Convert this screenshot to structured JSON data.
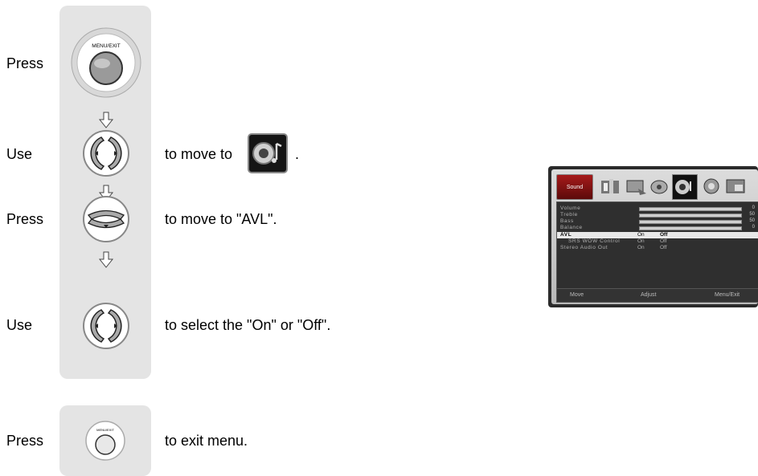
{
  "steps": [
    {
      "verb": "Press",
      "button": "menu-exit-button",
      "button_label": "MENU/EXIT",
      "text": ""
    },
    {
      "verb": "Use",
      "button": "left-right-button",
      "text": "to move to",
      "suffix": "."
    },
    {
      "verb": "Press",
      "button": "down-button",
      "text": "to move to  \"AVL\"."
    },
    {
      "verb": "Use",
      "button": "left-right-button",
      "text": "to select the \"On\" or \"Off\"."
    }
  ],
  "exit_step": {
    "verb": "Press",
    "button_label": "MENU/EXIT",
    "text": "to exit menu."
  },
  "osd": {
    "tab": "Sound",
    "icons": [
      "picture-icon",
      "screen-icon",
      "satellite-icon",
      "sound-icon",
      "settings-icon",
      "pip-icon"
    ],
    "rows": [
      {
        "label": "Volume",
        "value": "0",
        "fill": 0.0
      },
      {
        "label": "Treble",
        "value": "50",
        "fill": 0.5
      },
      {
        "label": "Bass",
        "value": "50",
        "fill": 0.5
      },
      {
        "label": "Balance",
        "value": "0",
        "fill": 0.5
      }
    ],
    "options": [
      {
        "label": "AVL",
        "on": "On",
        "off": "Off",
        "selected": true
      },
      {
        "label": "SRS WOW Control",
        "on": "On",
        "off": "Off",
        "selected": false
      },
      {
        "label": "Stereo Audio Out",
        "on": "On",
        "off": "Off",
        "selected": false
      }
    ],
    "footer": {
      "move": "Move",
      "adjust": "Adjust",
      "menu_exit": "Menu/Exit"
    }
  }
}
